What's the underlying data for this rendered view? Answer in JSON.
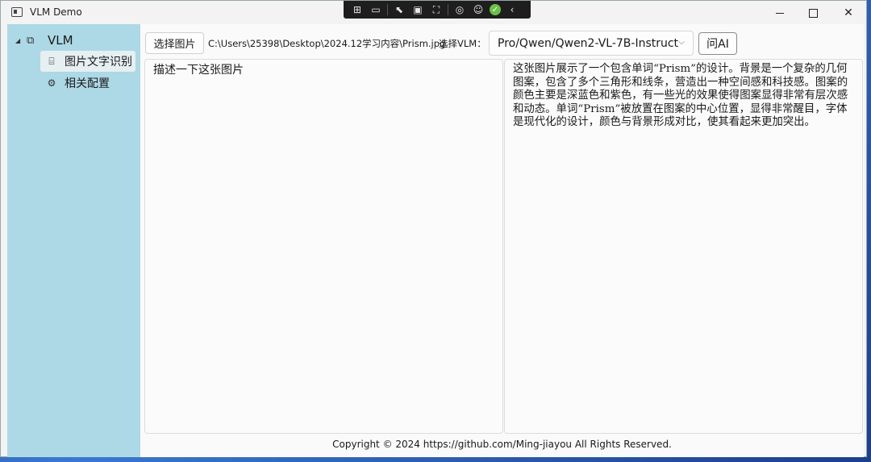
{
  "window": {
    "title": "VLM Demo",
    "icon": "app-window-icon",
    "controls": [
      "minimize-icon",
      "maximize-icon",
      "close-icon"
    ]
  },
  "debug_toolbar": {
    "icons": [
      "live-visual-tree-icon",
      "video-icon",
      "select-element-icon",
      "display-layout-adorners-icon",
      "track-focus-icon",
      "hot-reload-icon",
      "accessibility-icon",
      "check-icon",
      "collapse-chevron-icon"
    ]
  },
  "sidebar": {
    "root": {
      "label": "VLM",
      "icon": "cube-icon",
      "expanded": true
    },
    "items": [
      {
        "label": "图片文字识别",
        "icon": "text-recognition-icon",
        "selected": true
      },
      {
        "label": "相关配置",
        "icon": "gear-icon",
        "selected": false
      }
    ]
  },
  "toolbar": {
    "choose_image_label": "选择图片",
    "image_path": "C:\\Users\\25398\\Desktop\\2024.12学习内容\\Prism.jpg",
    "vlm_label": "选择VLM：",
    "vlm_selected": "Pro/Qwen/Qwen2-VL-7B-Instruct",
    "ask_label": "问AI"
  },
  "prompt_text": "描述一下这张图片",
  "response_text": "这张图片展示了一个包含单词“Prism”的设计。背景是一个复杂的几何图案，包含了多个三角形和线条，营造出一种空间感和科技感。图案的颜色主要是深蓝色和紫色，有一些光的效果使得图案显得非常有层次感和动态。单词“Prism”被放置在图案的中心位置，显得非常醒目，字体是现代化的设计，颜色与背景形成对比，使其看起来更加突出。",
  "footer": "Copyright © 2024 https://github.com/Ming-jiayou All Rights Reserved.",
  "colors": {
    "sidebar_bg": "#add8e6",
    "window_bg": "#f3f3f3",
    "selected_item_bg": "#e6eff2"
  }
}
